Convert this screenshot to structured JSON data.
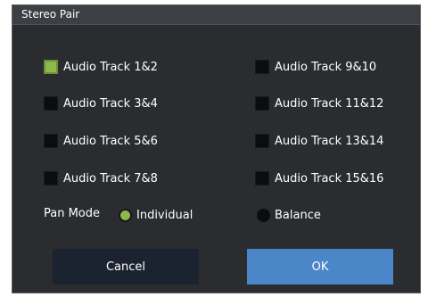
{
  "dialog": {
    "title": "Stereo Pair"
  },
  "tracks_left": [
    {
      "label": "Audio Track 1&2",
      "checked": true
    },
    {
      "label": "Audio Track 3&4",
      "checked": false
    },
    {
      "label": "Audio Track 5&6",
      "checked": false
    },
    {
      "label": "Audio Track 7&8",
      "checked": false
    }
  ],
  "tracks_right": [
    {
      "label": "Audio Track 9&10",
      "checked": false
    },
    {
      "label": "Audio Track 11&12",
      "checked": false
    },
    {
      "label": "Audio Track 13&14",
      "checked": false
    },
    {
      "label": "Audio Track 15&16",
      "checked": false
    }
  ],
  "pan_mode": {
    "label": "Pan Mode",
    "options": [
      {
        "label": "Individual",
        "selected": true
      },
      {
        "label": "Balance",
        "selected": false
      }
    ]
  },
  "buttons": {
    "cancel": "Cancel",
    "ok": "OK"
  },
  "colors": {
    "accent_green": "#8cb84c",
    "dialog_bg": "#2a2c30",
    "ok_blue": "#4a86c8",
    "cancel_navy": "#1c2330"
  }
}
